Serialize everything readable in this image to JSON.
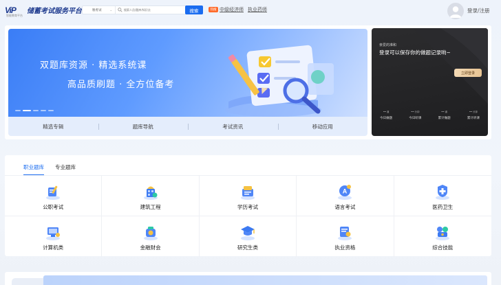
{
  "header": {
    "logo_mark": "ViP",
    "logo_sub": "智能教育平台",
    "logo_text": "储蓄考试服务平台",
    "search_category": "税考试",
    "search_placeholder": "搜索人员/题库/知识点",
    "search_button": "搜索",
    "hot_badge": "热搜",
    "link_1": "中级经济师",
    "link_2": "执业药师",
    "login_label": "登录/注册"
  },
  "banner": {
    "line1": "双题库资源 · 精选系统课",
    "line2": "高品质刷题 · 全方位备考",
    "dots_count": 5,
    "active_dot": 1
  },
  "quick_nav": [
    "精选专辑",
    "题库导航",
    "考试资讯",
    "移动应用"
  ],
  "side_panel": {
    "greeting": "亲爱的准和",
    "tip": "登录可以保存你的做题记录哟~",
    "login_button": "立即登录",
    "stats": [
      {
        "value": "--",
        "unit": "道",
        "label": "今日做题"
      },
      {
        "value": "--",
        "unit": "分钟",
        "label": "今日听课"
      },
      {
        "value": "--",
        "unit": "道",
        "label": "累计做题"
      },
      {
        "value": "--",
        "unit": "分钟",
        "label": "累计听课"
      }
    ]
  },
  "category_tabs": [
    "职业题库",
    "专业题库"
  ],
  "active_tab": 0,
  "categories": [
    {
      "label": "公职考试",
      "icon": "gov-exam-icon"
    },
    {
      "label": "建筑工程",
      "icon": "building-icon"
    },
    {
      "label": "学历考试",
      "icon": "diploma-icon"
    },
    {
      "label": "语言考试",
      "icon": "language-icon"
    },
    {
      "label": "医药卫生",
      "icon": "medicine-icon"
    },
    {
      "label": "计算机类",
      "icon": "computer-icon"
    },
    {
      "label": "金融财会",
      "icon": "finance-icon"
    },
    {
      "label": "研究生类",
      "icon": "graduate-cap-icon"
    },
    {
      "label": "执业资格",
      "icon": "certificate-icon"
    },
    {
      "label": "综合技能",
      "icon": "skills-icon"
    }
  ],
  "colors": {
    "accent": "#1a6cf0",
    "hot": "#ff6a2a",
    "side_bg": "#222224",
    "login_btn": "#ebca9c"
  }
}
